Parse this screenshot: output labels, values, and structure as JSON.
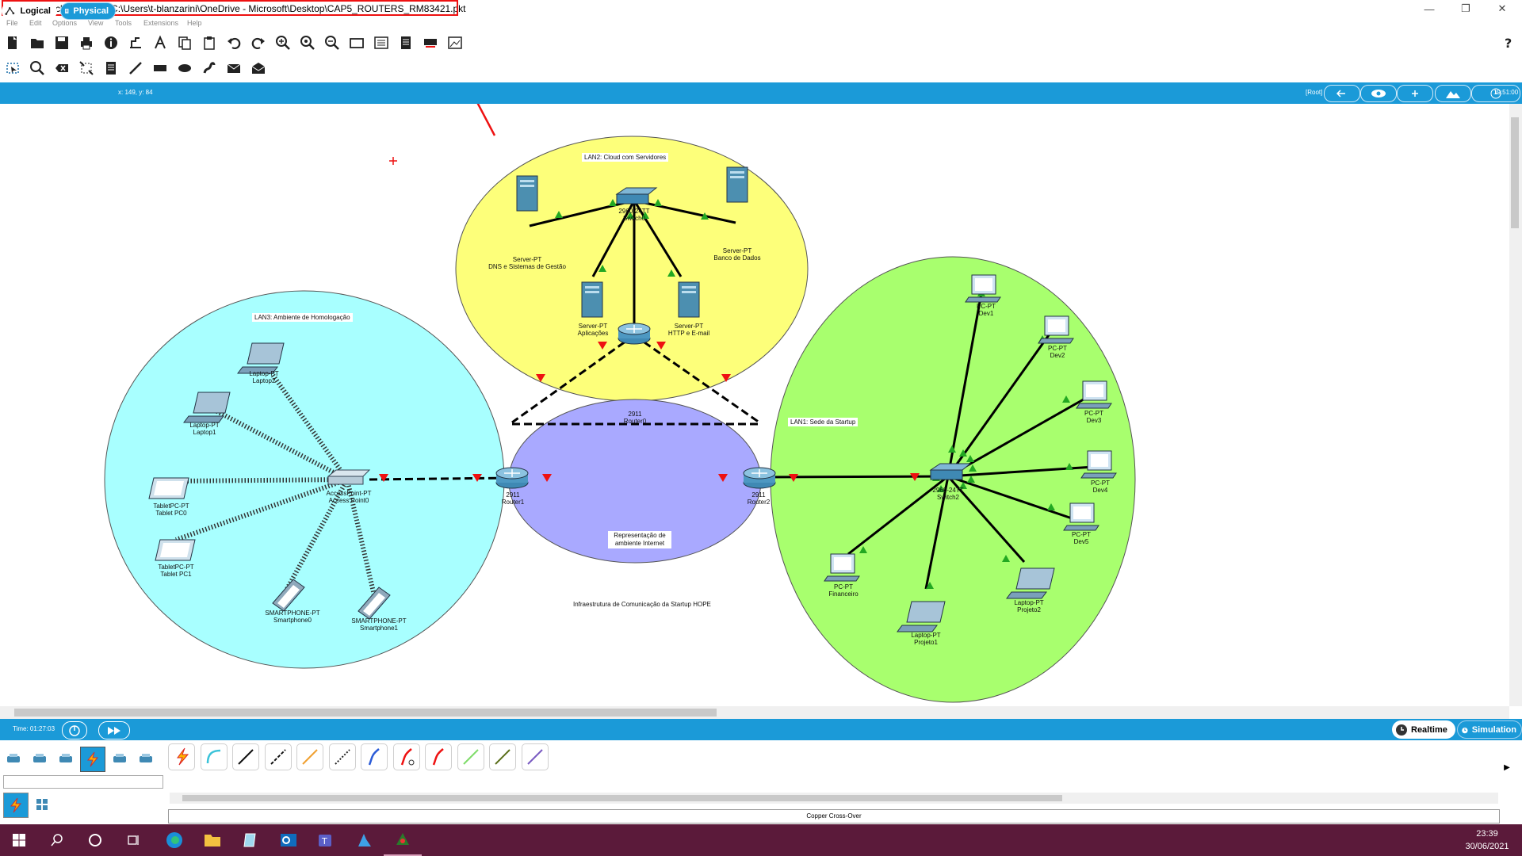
{
  "window": {
    "title": "Cisco Packet Tracer - C:\\Users\\t-blanzarini\\OneDrive - Microsoft\\Desktop\\CAP5_ROUTERS_RM83421.pkt",
    "controls": [
      "minimize",
      "restore",
      "close"
    ]
  },
  "menu": [
    "File",
    "Edit",
    "Options",
    "View",
    "Tools",
    "Extensions",
    "Help"
  ],
  "toolbar_main": [
    "new-icon",
    "open-icon",
    "save-icon",
    "print-icon",
    "info-icon",
    "network-wizard-icon",
    "activity-wizard-icon",
    "copy-icon",
    "paste-icon",
    "undo-icon",
    "redo-icon",
    "zoom-in-icon",
    "zoom-reset-icon",
    "zoom-out-icon",
    "drawing-palette-icon",
    "custom-device-icon",
    "notes-icon",
    "pdu-list-icon",
    "viewport-icon",
    "help-icon"
  ],
  "toolbar_common": [
    "select-icon",
    "inspect-icon",
    "delete-icon",
    "resize-icon",
    "note-icon",
    "line-icon",
    "rectangle-icon",
    "ellipse-icon",
    "freeform-icon",
    "simple-pdu-icon",
    "complex-pdu-icon"
  ],
  "tabs": {
    "logical": "Logical",
    "physical": "Physical"
  },
  "coords": "x: 149, y: 84",
  "root": "[Root]",
  "clock": "19:51:00",
  "network": {
    "zones": [
      {
        "id": "lan2",
        "label": "LAN2: Cloud com Servidores",
        "color": "#fdff7a"
      },
      {
        "id": "lan3",
        "label": "LAN3: Ambiente de Homologação",
        "color": "#a8ffff"
      },
      {
        "id": "internet",
        "label": "Representação de ambiente Internet",
        "color": "#a9a9ff"
      },
      {
        "id": "lan1",
        "label": "LAN1: Sede da Startup",
        "color": "#a8ff6e"
      }
    ],
    "caption": "Infraestrutura de Comunicação da Startup HOPE",
    "devices": {
      "switch0": {
        "model": "2960-24TT",
        "name": "Switch0"
      },
      "server_dns": {
        "model": "Server-PT",
        "name": "DNS e Sistemas de Gestão"
      },
      "server_db": {
        "model": "Server-PT",
        "name": "Banco de Dados"
      },
      "server_app": {
        "model": "Server-PT",
        "name": "Aplicações"
      },
      "server_http": {
        "model": "Server-PT",
        "name": "HTTP e E-mail"
      },
      "router0": {
        "model": "2911",
        "name": "Router0"
      },
      "router1": {
        "model": "2911",
        "name": "Router1"
      },
      "router2": {
        "model": "2911",
        "name": "Router2"
      },
      "ap0": {
        "model": "AccessPoint-PT",
        "name": "Access Point0"
      },
      "laptop2": {
        "model": "Laptop-PT",
        "name": "Laptop2"
      },
      "laptop1": {
        "model": "Laptop-PT",
        "name": "Laptop1"
      },
      "tablet0": {
        "model": "TabletPC-PT",
        "name": "Tablet PC0"
      },
      "tablet1": {
        "model": "TabletPC-PT",
        "name": "Tablet PC1"
      },
      "phone0": {
        "model": "SMARTPHONE-PT",
        "name": "Smartphone0"
      },
      "phone1": {
        "model": "SMARTPHONE-PT",
        "name": "Smartphone1"
      },
      "switch2": {
        "model": "2960-24TT",
        "name": "Switch2"
      },
      "dev1": {
        "model": "PC-PT",
        "name": "Dev1"
      },
      "dev2": {
        "model": "PC-PT",
        "name": "Dev2"
      },
      "dev3": {
        "model": "PC-PT",
        "name": "Dev3"
      },
      "dev4": {
        "model": "PC-PT",
        "name": "Dev4"
      },
      "dev5": {
        "model": "PC-PT",
        "name": "Dev5"
      },
      "financeiro": {
        "model": "PC-PT",
        "name": "Financeiro"
      },
      "projeto1": {
        "model": "Laptop-PT",
        "name": "Projeto1"
      },
      "projeto2": {
        "model": "Laptop-PT",
        "name": "Projeto2"
      }
    }
  },
  "sim": {
    "time": "Time: 01:27:03",
    "realtime": "Realtime",
    "simulation": "Simulation"
  },
  "palette": {
    "categories": [
      "network-devices-icon",
      "end-devices-icon",
      "components-icon",
      "connections-icon",
      "misc-icon",
      "multiuser-icon"
    ],
    "connections": [
      "automatic-icon",
      "console-icon",
      "copper-straight-icon",
      "copper-cross-icon",
      "fiber-icon",
      "phone-icon",
      "coaxial-icon",
      "serial-dce-icon",
      "serial-dte-icon",
      "octal-icon",
      "iot-custom-icon",
      "usb-icon"
    ],
    "selected_name": "Copper Cross-Over"
  },
  "taskbar": {
    "time": "23:39",
    "date": "30/06/2021"
  }
}
